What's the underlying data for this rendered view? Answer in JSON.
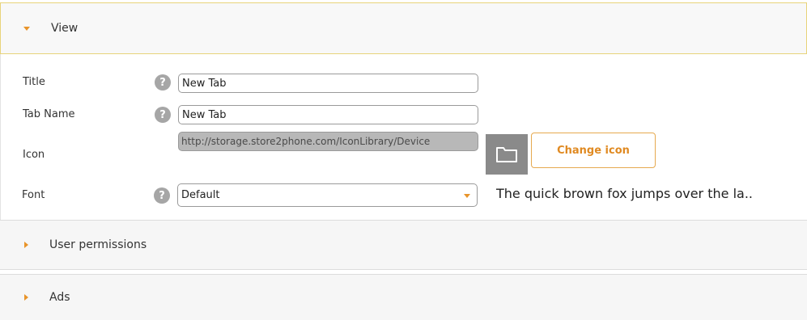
{
  "panels": {
    "view": {
      "label": "View",
      "expanded": true
    },
    "user_permissions": {
      "label": "User permissions",
      "expanded": false
    },
    "ads": {
      "label": "Ads",
      "expanded": false
    }
  },
  "form": {
    "title": {
      "label": "Title",
      "value": "New Tab"
    },
    "tab_name": {
      "label": "Tab Name",
      "value": "New Tab"
    },
    "icon": {
      "label": "Icon",
      "value": "http://storage.store2phone.com/IconLibrary/Device",
      "change_button_label": "Change icon"
    },
    "font": {
      "label": "Font",
      "selected": "Default",
      "preview_text": "The quick brown fox jumps over the la.."
    },
    "help_glyph": "?"
  },
  "icons": {
    "expanded_caret": "caret-down-icon",
    "collapsed_caret": "caret-right-icon",
    "help": "help-icon",
    "folder": "folder-icon",
    "dropdown_arrow": "chevron-down-icon"
  },
  "colors": {
    "accent": "#e8942a",
    "header_border": "#e8d37a",
    "button_border": "#e6a94f",
    "folder_button_bg": "#8a8a8a",
    "help_bg": "#a6a6a6"
  }
}
